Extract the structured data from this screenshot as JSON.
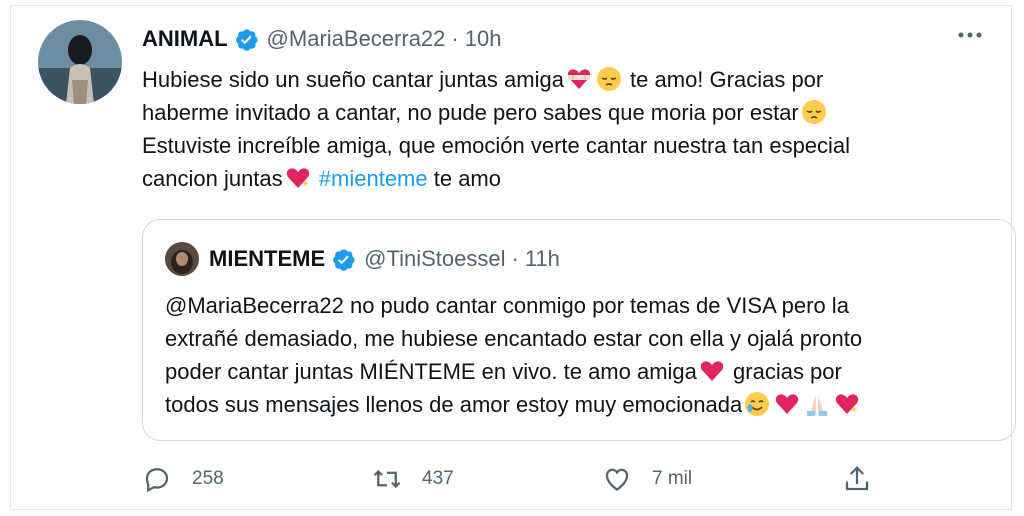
{
  "tweet": {
    "display_name": "ANIMAL",
    "handle": "@MariaBecerra22",
    "separator": "·",
    "time": "10h",
    "text_part1": "Hubiese sido un sueño cantar juntas amiga",
    "text_part2": " te amo! Gracias por\nhaberme invitado a cantar, no pude pero sabes que moria por estar",
    "text_part3": "\nEstuviste increíble amiga, que emoción verte cantar nuestra tan especial\ncancion juntas",
    "hashtag": "#mienteme",
    "text_part4": " te amo"
  },
  "quoted": {
    "display_name": "MIENTEME",
    "handle": "@TiniStoessel",
    "separator": "·",
    "time": "11h",
    "text_part1": "@MariaBecerra22 no pudo cantar conmigo por temas de VISA pero la\nextrañé demasiado, me hubiese encantado estar con ella y ojalá pronto\npoder cantar juntas MIÉNTEME en vivo. te amo amiga",
    "text_part2": " gracias por\ntodos sus mensajes llenos de amor estoy muy emocionada"
  },
  "actions": {
    "reply_count": "258",
    "retweet_count": "437",
    "like_count": "7 mil"
  },
  "colors": {
    "accent": "#1d9bf0",
    "text_secondary": "#536471",
    "heart": "#e0245e"
  }
}
